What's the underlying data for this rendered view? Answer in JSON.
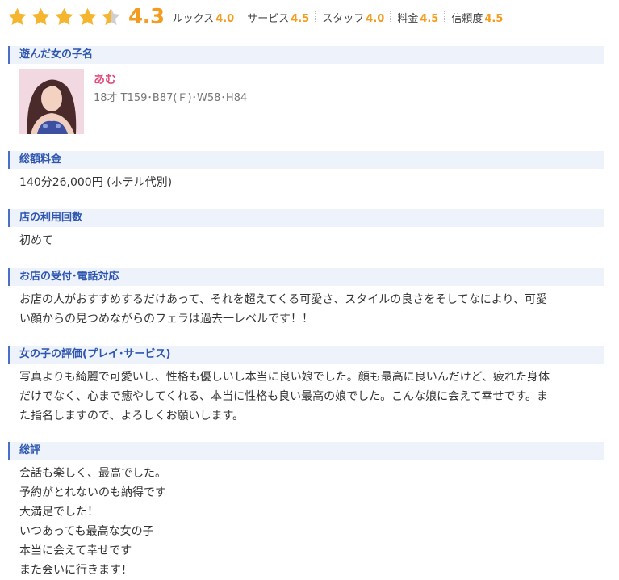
{
  "rating": {
    "score": "4.3",
    "stars_filled": 4.3,
    "stars_total": 5,
    "star_color": "#f5b52e",
    "star_empty_color": "#cfcfcf",
    "categories": [
      {
        "label": "ルックス",
        "value": "4.0"
      },
      {
        "label": "サービス",
        "value": "4.5"
      },
      {
        "label": "スタッフ",
        "value": "4.0"
      },
      {
        "label": "料金",
        "value": "4.5"
      },
      {
        "label": "信頼度",
        "value": "4.5"
      }
    ]
  },
  "girl_section": {
    "title": "遊んだ女の子名",
    "name": "あむ",
    "spec": "18才 T159･B87(Ｆ)･W58･H84"
  },
  "price_section": {
    "title": "総額料金",
    "text": "140分26,000円 (ホテル代別)"
  },
  "visits_section": {
    "title": "店の利用回数",
    "text": "初めて"
  },
  "reception_section": {
    "title": "お店の受付･電話対応",
    "lines": [
      "お店の人がおすすめするだけあって、それを超えてくる可愛さ、スタイルの良さをそしてなにより、可愛",
      "い顔からの見つめながらのフェラは過去一レベルです！！"
    ]
  },
  "evaluation_section": {
    "title": "女の子の評価(プレイ･サービス)",
    "lines": [
      "写真よりも綺麗で可愛いし、性格も優しいし本当に良い娘でした。顔も最高に良いんだけど、疲れた身体",
      "だけでなく、心まで癒やしてくれる、本当に性格も良い最高の娘でした。こんな娘に会えて幸せです。ま",
      "た指名しますので、よろしくお願いします。"
    ]
  },
  "summary_section": {
    "title": "総評",
    "lines": [
      "会話も楽しく、最高でした。",
      "予約がとれないのも納得です",
      "大満足でした！",
      "いつあっても最高な女の子",
      "本当に会えて幸せです",
      "また会いに行きます！"
    ]
  }
}
